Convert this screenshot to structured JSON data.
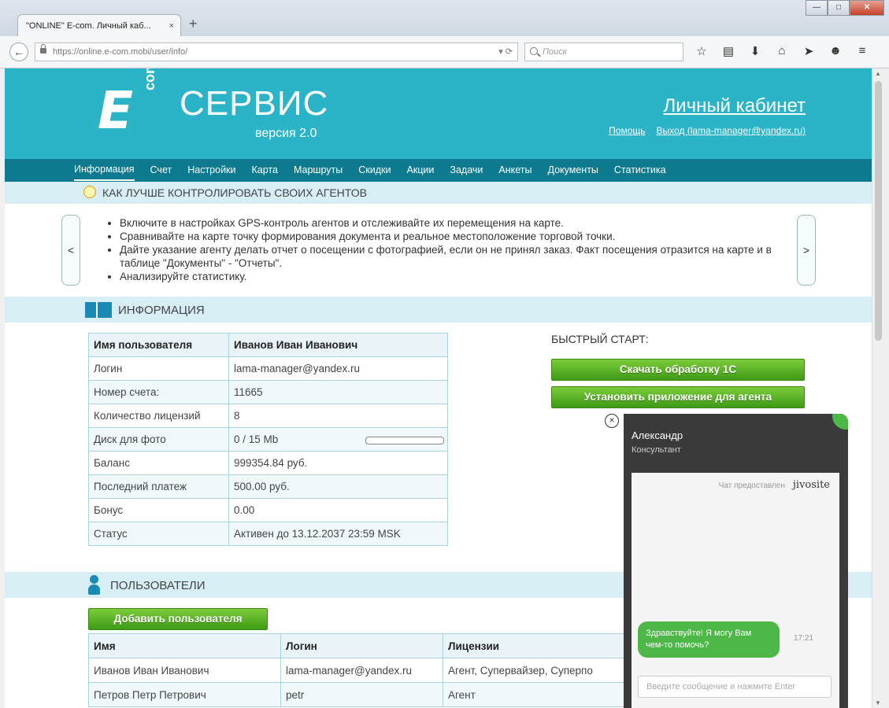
{
  "browser": {
    "tab_title": "\"ONLINE\" E-com. Личный каб...",
    "tab_close": "×",
    "new_tab": "+",
    "url": "https://online.e-com.mobi/user/info/",
    "search_placeholder": "Поиск",
    "window_buttons": [
      "—",
      "□",
      "✕"
    ],
    "toolbar_icons": [
      "star-icon",
      "clipboard-icon",
      "download-icon",
      "home-icon",
      "send-icon",
      "smiley-icon",
      "menu-icon"
    ]
  },
  "header": {
    "logo_e": "E",
    "logo_com": "com",
    "title": "СЕРВИС",
    "version": "версия 2.0",
    "cabinet": "Личный кабинет",
    "help": "Помощь",
    "logout": "Выход (lama-manager@yandex.ru)"
  },
  "nav": [
    "Информация",
    "Счет",
    "Настройки",
    "Карта",
    "Маршруты",
    "Скидки",
    "Акции",
    "Задачи",
    "Анкеты",
    "Документы",
    "Статистика"
  ],
  "tips": {
    "title": "КАК ЛУЧШЕ КОНТРОЛИРОВАТЬ СВОИХ АГЕНТОВ",
    "prev": "<",
    "next": ">",
    "items": [
      "Включите в настройках GPS-контроль агентов и отслеживайте их перемещения на карте.",
      "Сравнивайте на карте точку формирования документа и реальное местоположение торговой точки.",
      "Дайте указание агенту делать отчет о посещении с фотографией, если он не принял заказ. Факт посещения отразится на карте и в таблице \"Документы\" - \"Отчеты\".",
      "Анализируйте статистику."
    ]
  },
  "info": {
    "section_title": "ИНФОРМАЦИЯ",
    "rows": [
      [
        "Имя пользователя",
        "Иванов Иван Иванович"
      ],
      [
        "Логин",
        "lama-manager@yandex.ru"
      ],
      [
        "Номер счета:",
        "11665"
      ],
      [
        "Количество лицензий",
        "8"
      ],
      [
        "Диск для фото",
        "0 / 15 Mb"
      ],
      [
        "Баланс",
        "999354.84 руб."
      ],
      [
        "Последний платеж",
        "500.00 руб."
      ],
      [
        "Бонус",
        "0.00"
      ],
      [
        "Статус",
        "Активен до 13.12.2037 23:59 MSK"
      ]
    ],
    "disk_used_fraction": 0
  },
  "quick_start": {
    "title": "БЫСТРЫЙ СТАРТ:",
    "download_1c": "Скачать обработку 1С",
    "install_app": "Установить приложение для агента"
  },
  "users": {
    "section_title": "ПОЛЬЗОВАТЕЛИ",
    "add_button": "Добавить пользователя",
    "columns": [
      "Имя",
      "Логин",
      "Лицензии"
    ],
    "rows": [
      [
        "Иванов Иван Иванович",
        "lama-manager@yandex.ru",
        "Агент, Супервайзер, Суперпо"
      ],
      [
        "Петров Петр Петрович",
        "petr",
        "Агент"
      ]
    ]
  },
  "chat": {
    "close": "×",
    "agent_name": "Александр",
    "agent_role": "Консультант",
    "credit_text": "Чат предоставлен",
    "credit_brand": "jivosite",
    "message": "Здравствуйте! Я могу Вам чем-то помочь?",
    "time": "17:21",
    "input_placeholder": "Введите сообщение и нажмите Enter"
  },
  "colors": {
    "header": "#2bb3c8",
    "nav": "#0e7a8f",
    "section": "#d7eef4",
    "button_green": "#4da81e",
    "chat_bg": "#3a3a3a",
    "chat_accent": "#4db848"
  }
}
